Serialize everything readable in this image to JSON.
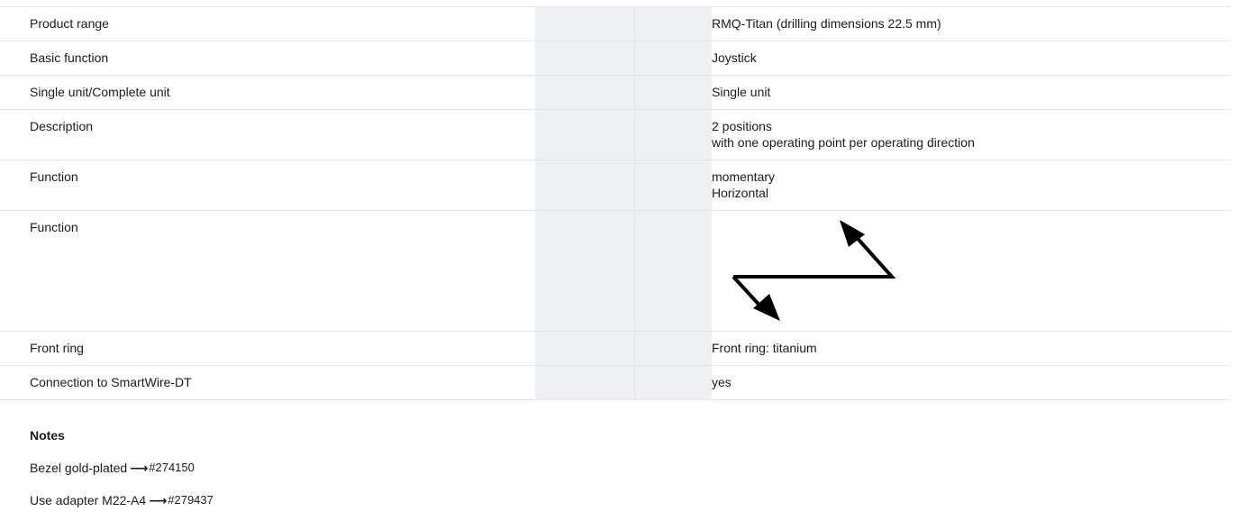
{
  "rows": [
    {
      "label": "Product range",
      "value": [
        "RMQ-Titan (drilling dimensions 22.5 mm)"
      ]
    },
    {
      "label": "Basic function",
      "value": [
        "Joystick"
      ]
    },
    {
      "label": "Single unit/Complete unit",
      "value": [
        "Single unit"
      ]
    },
    {
      "label": "Description",
      "value": [
        "2 positions",
        "with one operating point per operating direction"
      ]
    },
    {
      "label": "Function",
      "value": [
        "momentary",
        "Horizontal"
      ]
    },
    {
      "label": "Function",
      "value": [],
      "diagram": "joystick-horizontal-arrows-icon"
    },
    {
      "label": "Front ring",
      "value": [
        "Front ring: titanium"
      ]
    },
    {
      "label": "Connection to SmartWire-DT",
      "value": [
        "yes"
      ]
    }
  ],
  "notes": {
    "title": "Notes",
    "items": [
      {
        "text": "Bezel gold-plated",
        "arrow": "⟶",
        "ref": "#274150"
      },
      {
        "text": "Use adapter M22-A4",
        "arrow": "⟶",
        "ref": "#279437"
      }
    ]
  },
  "colors": {
    "heading": "#0a5fb8",
    "stripe": "#eef0f4",
    "border": "#e4e6ea"
  }
}
